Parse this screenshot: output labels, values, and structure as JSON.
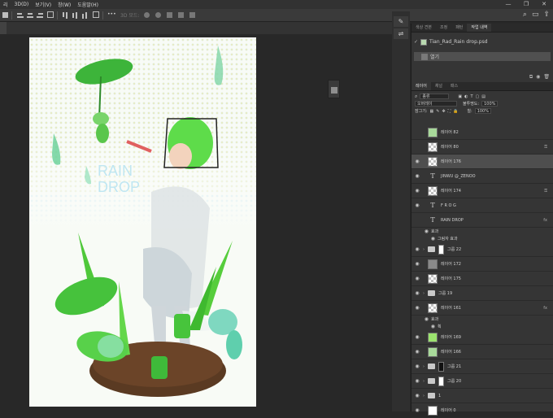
{
  "menubar": {
    "items": [
      "리",
      "3D(D)",
      "보기(V)",
      "창(W)",
      "도움말(H)"
    ],
    "window_controls": [
      "—",
      "❐",
      "✕"
    ]
  },
  "options_bar": {
    "dimmed_label": "3D 모드:"
  },
  "panel_top": {
    "tabs": [
      "색상 견본",
      "조정",
      "패턴",
      "작업 내역"
    ],
    "active_tab": "작업 내역",
    "snapshot_file": "Tian_Rad_Rain drop.psd",
    "history_items": [
      "열기"
    ]
  },
  "layers_panel": {
    "tabs": [
      "레이어",
      "채널",
      "패스"
    ],
    "active_tab": "레이어",
    "kind_filter": "종류",
    "blend_mode": "오버레이",
    "opacity_label": "불투명도:",
    "opacity_value": "100%",
    "lock_label": "잠그기:",
    "fill_label": "칠:",
    "fill_value": "100%",
    "layers": [
      {
        "kind": "pixel",
        "name": "레이어 82",
        "visible": false,
        "thumb": "art"
      },
      {
        "kind": "pixel",
        "name": "레이어 80",
        "visible": false,
        "thumb": "checker",
        "locked": true
      },
      {
        "kind": "pixel",
        "name": "레이어 176",
        "visible": true,
        "thumb": "checker",
        "selected": true
      },
      {
        "kind": "text",
        "name": "JINWU @_ZENOO",
        "visible": true
      },
      {
        "kind": "pixel",
        "name": "레이어 174",
        "visible": true,
        "thumb": "checker",
        "locked": true
      },
      {
        "kind": "text",
        "name": "F R O G",
        "visible": true
      },
      {
        "kind": "text",
        "name": "RAIN DROP",
        "visible": false,
        "fx": "fx"
      },
      {
        "kind": "effect",
        "name": "효과"
      },
      {
        "kind": "effect-item",
        "name": "그림자 효과"
      },
      {
        "kind": "group",
        "name": "그룹 22",
        "visible": true,
        "mask": "white"
      },
      {
        "kind": "pixel",
        "name": "레이어 172",
        "visible": true,
        "thumb": "grey"
      },
      {
        "kind": "pixel",
        "name": "레이어 175",
        "visible": true,
        "thumb": "checker"
      },
      {
        "kind": "group",
        "name": "그룹 19",
        "visible": true
      },
      {
        "kind": "pixel",
        "name": "레이어 161",
        "visible": true,
        "thumb": "checker",
        "fx": "fx"
      },
      {
        "kind": "effect",
        "name": "효과"
      },
      {
        "kind": "effect-item",
        "name": "획"
      },
      {
        "kind": "pixel",
        "name": "레이어 169",
        "visible": true,
        "thumb": "green"
      },
      {
        "kind": "pixel",
        "name": "레이어 166",
        "visible": true,
        "thumb": "art"
      },
      {
        "kind": "group",
        "name": "그룹 21",
        "visible": true,
        "mask": "dark"
      },
      {
        "kind": "group",
        "name": "그룹 20",
        "visible": true,
        "mask": "white"
      },
      {
        "kind": "group",
        "name": "1",
        "visible": true
      },
      {
        "kind": "pixel",
        "name": "레이어 0",
        "visible": true,
        "thumb": "white"
      }
    ]
  },
  "artwork": {
    "title_line1": "RAIN",
    "title_line2": "DROP",
    "colors": {
      "leaf": "#4fc83a",
      "hair": "#5ee04a",
      "soil": "#6b4428",
      "bg": "#f8fbf6"
    }
  }
}
